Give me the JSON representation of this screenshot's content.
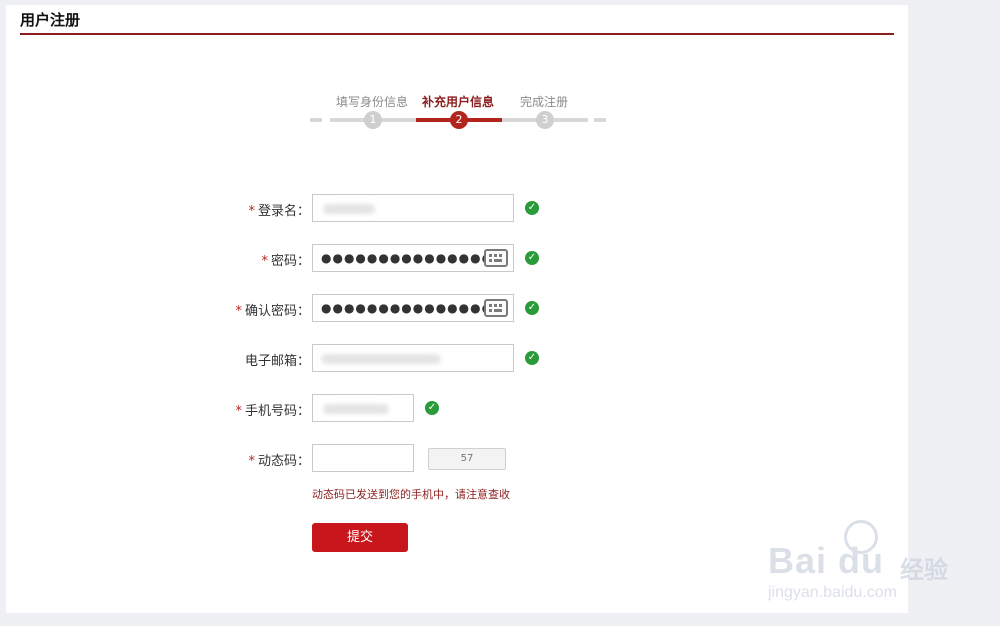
{
  "header": {
    "title": "用户注册"
  },
  "steps": [
    {
      "label": "填写身份信息",
      "number": "1",
      "active": false
    },
    {
      "label": "补充用户信息",
      "number": "2",
      "active": true
    },
    {
      "label": "完成注册",
      "number": "3",
      "active": false
    }
  ],
  "form": {
    "login_name": {
      "label": "登录名：",
      "required": "*"
    },
    "password": {
      "label": "密码：",
      "required": "*",
      "value": "●●●●●●●●●●●●●●●"
    },
    "confirm_password": {
      "label": "确认密码：",
      "required": "*",
      "value": "●●●●●●●●●●●●●●●"
    },
    "email": {
      "label": "电子邮箱："
    },
    "phone": {
      "label": "手机号码：",
      "required": "*"
    },
    "dynamic_code": {
      "label": "动态码：",
      "required": "*",
      "countdown": "57"
    },
    "hint": "动态码已发送到您的手机中，请注意查收",
    "submit_label": "提交"
  },
  "icons": {
    "valid": "check-circle-icon",
    "keyboard": "keyboard-icon"
  },
  "colors": {
    "accent": "#b1251e",
    "button": "#c8161d",
    "valid": "#2a9a3a"
  },
  "watermark": {
    "brand": "Bai du",
    "product": "经验",
    "url": "jingyan.baidu.com"
  }
}
